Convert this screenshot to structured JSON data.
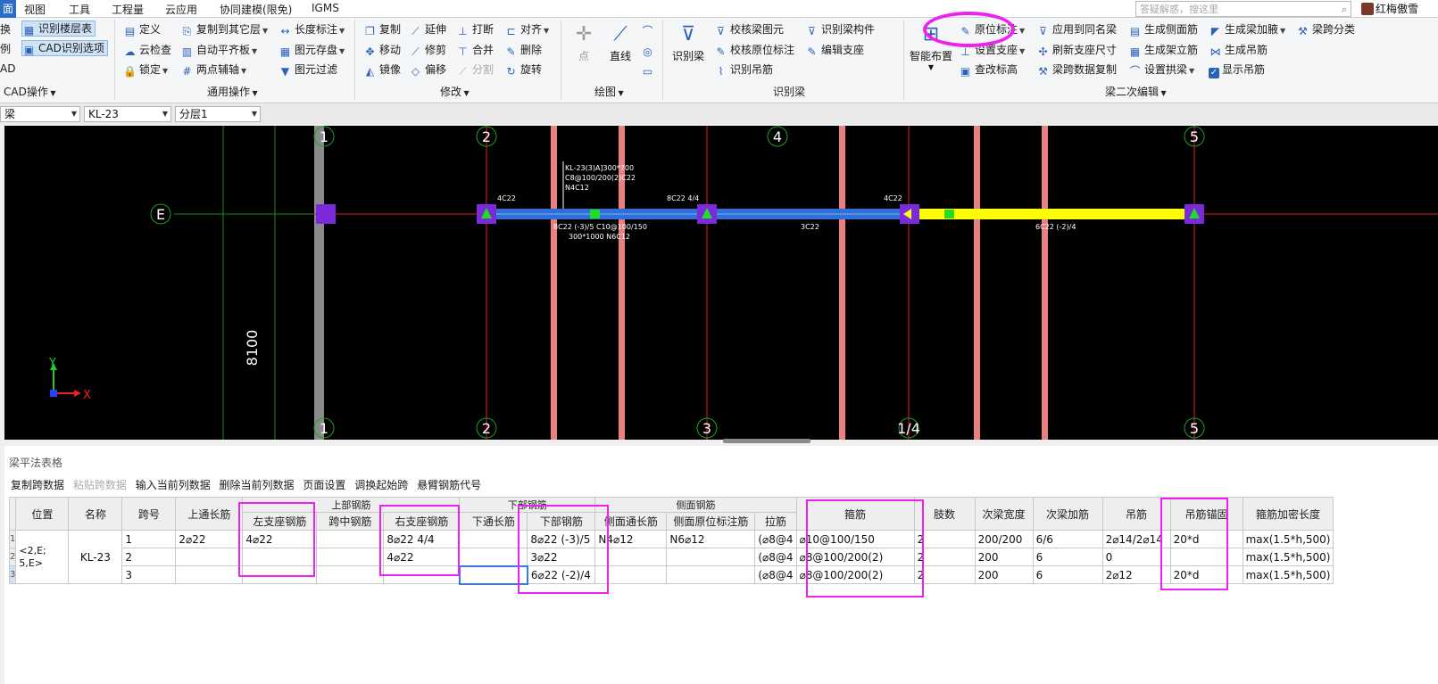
{
  "menu": {
    "items": [
      "面",
      "视图",
      "工具",
      "工程量",
      "云应用",
      "协同建模(限免)",
      "IGMS"
    ],
    "search_placeholder": "答疑解惑，搜这里",
    "user_name": "红梅傲雪"
  },
  "ribbon": {
    "cad_ops": {
      "items": [
        "换",
        "识别楼层表",
        "例",
        "CAD识别选项",
        "AD"
      ],
      "label": "CAD操作"
    },
    "general": {
      "items": [
        "定义",
        "复制到其它层",
        "长度标注",
        "云检查",
        "自动平齐板",
        "图元存盘",
        "锁定",
        "两点辅轴",
        "图元过滤"
      ],
      "label": "通用操作"
    },
    "modify": {
      "items": [
        "复制",
        "延伸",
        "打断",
        "对齐",
        "移动",
        "修剪",
        "合并",
        "删除",
        "镜像",
        "偏移",
        "分割",
        "旋转"
      ],
      "label": "修改"
    },
    "draw": {
      "items": [
        "点",
        "直线"
      ],
      "label": "绘图"
    },
    "recognize": {
      "items": [
        "识别梁",
        "校核梁图元",
        "识别梁构件",
        "校核原位标注",
        "编辑支座",
        "识别吊筋"
      ],
      "label": "识别梁"
    },
    "secondary": {
      "items": [
        "智能布置",
        "原位标注",
        "应用到同名梁",
        "生成侧面筋",
        "生成梁加腋",
        "梁跨分类",
        "设置支座",
        "刷新支座尺寸",
        "生成架立筋",
        "生成吊筋",
        "查改标高",
        "梁跨数据复制",
        "设置拱梁",
        "显示吊筋"
      ],
      "label": "梁二次编辑"
    }
  },
  "selectors": [
    "梁",
    "KL-23",
    "分层1"
  ],
  "canvas": {
    "axis_top": [
      "1",
      "2",
      "4",
      "5"
    ],
    "axis_bottom": [
      "1",
      "2",
      "3",
      "1/4",
      "5"
    ],
    "axis_left": "E",
    "dimension": "8100",
    "beam_annot_1": "KL-23(3)A]300*700",
    "beam_annot_2": "C8@100/200(2)C22",
    "beam_annot_3": "N4C12",
    "top_text_1": "4C22",
    "top_text_2": "8C22 4/4",
    "top_text_3": "4C22",
    "bot_text_1": "8C22 (-3)/5 C10@100/150",
    "bot_text_2": "300*1000 N6C12",
    "bot_text_3": "3C22",
    "bot_text_4": "6C22 (-2)/4",
    "coord_x": "X",
    "coord_y": "Y"
  },
  "panel": {
    "title": "梁平法表格",
    "toolbar": [
      "复制跨数据",
      "粘贴跨数据",
      "输入当前列数据",
      "删除当前列数据",
      "页面设置",
      "调换起始跨",
      "悬臂钢筋代号"
    ],
    "group_headers": {
      "top_rebar": "上部钢筋",
      "bottom_rebar": "下部钢筋",
      "side_rebar": "侧面钢筋"
    },
    "columns": [
      "位置",
      "名称",
      "跨号",
      "上通长筋",
      "左支座钢筋",
      "跨中钢筋",
      "右支座钢筋",
      "下通长筋",
      "下部钢筋",
      "侧面通长筋",
      "侧面原位标注筋",
      "拉筋",
      "箍筋",
      "肢数",
      "次梁宽度",
      "次梁加筋",
      "吊筋",
      "吊筋锚固",
      "箍筋加密长度"
    ],
    "position": "<2,E;\n5,E>",
    "name": "KL-23",
    "rows": [
      [
        "1",
        "2⌀22",
        "4⌀22",
        "",
        "8⌀22 4/4",
        "",
        "8⌀22 (-3)/5",
        "N4⌀12",
        "N6⌀12",
        "(⌀8@4",
        "⌀10@100/150",
        "2",
        "200/200",
        "6/6",
        "2⌀14/2⌀14",
        "20*d",
        "max(1.5*h,500)"
      ],
      [
        "2",
        "",
        "",
        "",
        "4⌀22",
        "",
        "3⌀22",
        "",
        "",
        "(⌀8@4",
        "⌀8@100/200(2)",
        "2",
        "200",
        "6",
        "0",
        "",
        "max(1.5*h,500)"
      ],
      [
        "3",
        "",
        "",
        "",
        "",
        "",
        "6⌀22 (-2)/4",
        "",
        "",
        "(⌀8@4",
        "⌀8@100/200(2)",
        "2",
        "200",
        "6",
        "2⌀12",
        "20*d",
        "max(1.5*h,500)"
      ]
    ],
    "row_numbers": [
      "1",
      "2",
      "3"
    ]
  },
  "colors": {
    "accent": "#2b6cc4",
    "highlight": "#ee22ee",
    "beam_blue": "#2f6fd8",
    "beam_yellow": "#ffff00",
    "column_red": "#e88080"
  }
}
